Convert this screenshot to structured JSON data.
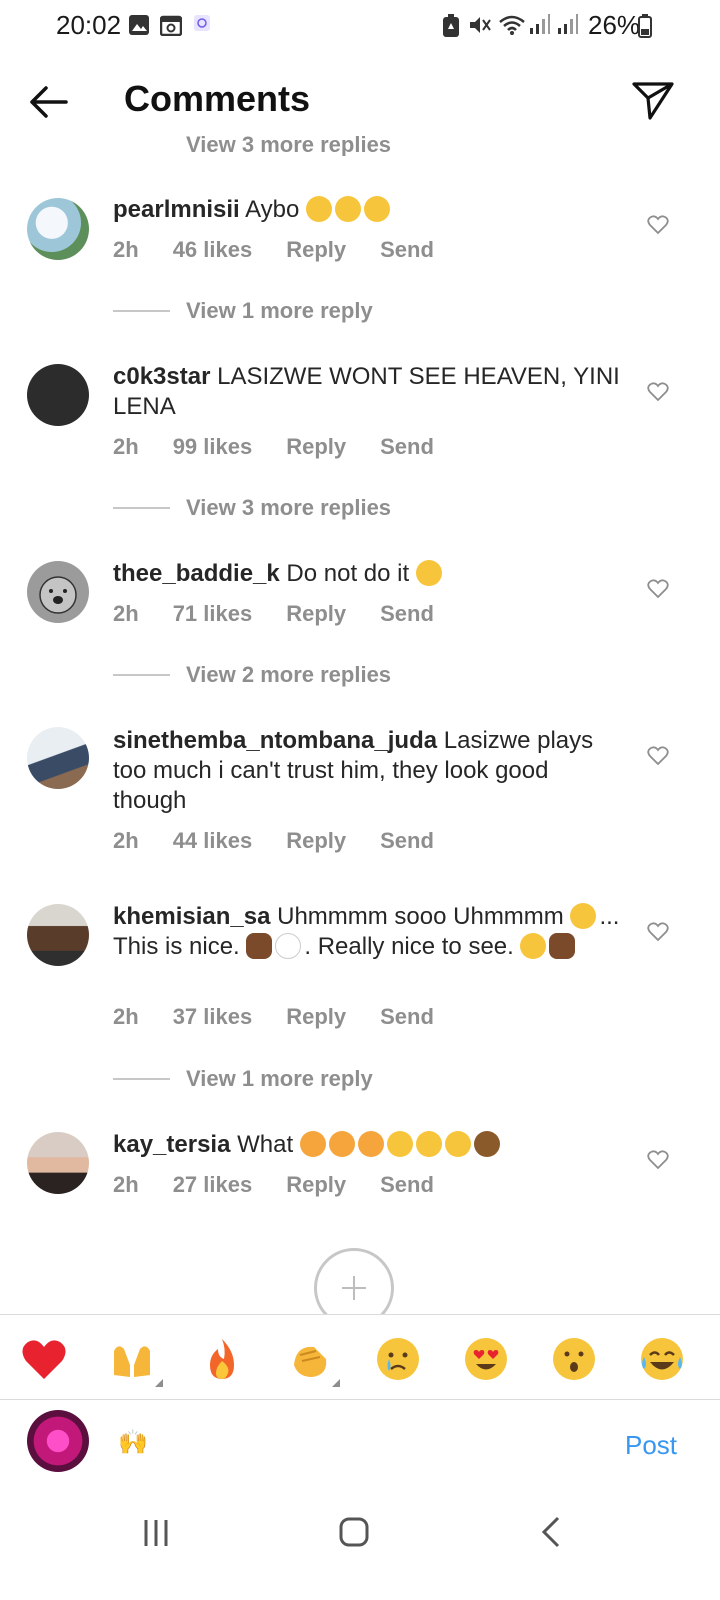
{
  "status_bar": {
    "time": "20:02",
    "battery": "26%",
    "icons": [
      "gallery-icon",
      "calendar-icon",
      "app-icon",
      "battery-saver-icon",
      "mute-icon",
      "wifi-icon",
      "signal-icon",
      "signal-icon",
      "battery-icon"
    ]
  },
  "header": {
    "title": "Comments",
    "back_icon": "arrow-left-icon",
    "send_icon": "paper-plane-icon"
  },
  "partial_row": {
    "text": "View 3 more replies"
  },
  "comments": [
    {
      "username": "pearlmnisii",
      "text": "Aybo",
      "emojis": [
        "tears-of-joy",
        "tears-of-joy",
        "tears-of-joy"
      ],
      "time": "2h",
      "likes": "46 likes",
      "reply": "Reply",
      "send": "Send",
      "view_more": "View 1 more reply"
    },
    {
      "username": "c0k3star",
      "text": "LASIZWE WONT SEE HEAVEN, YINI LENA",
      "time": "2h",
      "likes": "99 likes",
      "reply": "Reply",
      "send": "Send",
      "view_more": "View 3 more replies"
    },
    {
      "username": "thee_baddie_k",
      "text": "Do not do it",
      "emojis": [
        "hushed-face"
      ],
      "time": "2h",
      "likes": "71 likes",
      "reply": "Reply",
      "send": "Send",
      "view_more": "View 2 more replies"
    },
    {
      "username": "sinethemba_ntombana_juda",
      "text": "Lasizwe plays too much i can't trust him, they look good though",
      "time": "2h",
      "likes": "44 likes",
      "reply": "Reply",
      "send": "Send"
    },
    {
      "username": "khemisian_sa",
      "text_1": "Uhmmmm sooo Uhmmmm",
      "text_2": "... This is nice.",
      "text_3": ". Really nice to see.",
      "emojis": [
        "downcast-sweat",
        "crossed-fingers",
        "eyes",
        "smirking-face",
        "crossed-fingers"
      ],
      "time": "2h",
      "likes": "37 likes",
      "reply": "Reply",
      "send": "Send",
      "view_more": "View 1 more reply"
    },
    {
      "username": "kay_tersia",
      "text": "What",
      "emojis": [
        "tired-face",
        "tired-face",
        "tired-face",
        "tears-of-joy",
        "tears-of-joy",
        "tears-of-joy",
        "see-no-evil-monkey"
      ],
      "time": "2h",
      "likes": "27 likes",
      "reply": "Reply",
      "send": "Send"
    }
  ],
  "load_more_icon": "plus-circle-icon",
  "quick_emojis": [
    "red-heart",
    "raising-hands",
    "fire",
    "clapping-hands",
    "crying-face",
    "heart-eyes",
    "hushed-face",
    "tears-of-joy"
  ],
  "composer": {
    "value": "🙌",
    "post_label": "Post"
  },
  "nav_bar": {
    "icons": [
      "recents-icon",
      "home-icon",
      "back-icon"
    ]
  },
  "colors": {
    "link_blue": "#3897f0",
    "meta_gray": "#8e8e8e",
    "text": "#262626"
  }
}
